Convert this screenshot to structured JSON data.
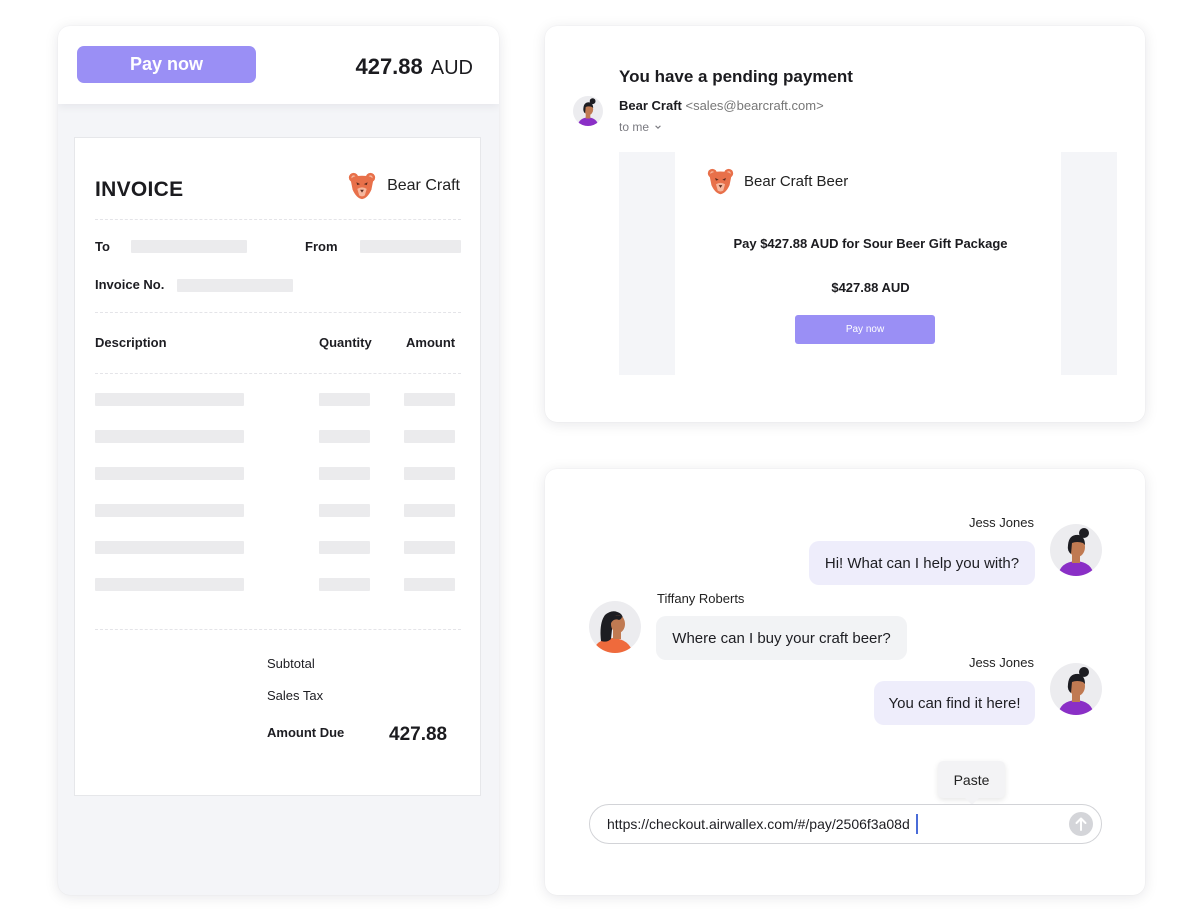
{
  "colors": {
    "accent": "#9a8ff5",
    "bear_orange": "#e8704a",
    "agent_bubble": "#eeedfb",
    "customer_bubble": "#f2f3f5"
  },
  "invoice_card": {
    "pay_button_label": "Pay now",
    "total_amount": "427.88",
    "total_currency": "AUD",
    "title": "INVOICE",
    "brand_icon": "bear-icon",
    "brand_name": "Bear Craft",
    "to_label": "To",
    "from_label": "From",
    "invoice_no_label": "Invoice No.",
    "columns": [
      "Description",
      "Quantity",
      "Amount"
    ],
    "placeholder_rows": 6,
    "subtotal_label": "Subtotal",
    "sales_tax_label": "Sales Tax",
    "amount_due_label": "Amount Due",
    "amount_due_value": "427.88"
  },
  "email_card": {
    "subject": "You have a pending payment",
    "sender_name": "Bear Craft",
    "sender_email": "<sales@bearcraft.com>",
    "to_line": "to me",
    "brand_name": "Bear Craft Beer",
    "pay_line": "Pay $427.88 AUD for Sour Beer Gift Package",
    "amount_line": "$427.88 AUD",
    "pay_button_label": "Pay now"
  },
  "chat_card": {
    "messages": [
      {
        "sender": "Jess Jones",
        "role": "agent",
        "text": "Hi! What can I help you with?"
      },
      {
        "sender": "Tiffany Roberts",
        "role": "customer",
        "text": "Where can I buy your craft beer?"
      },
      {
        "sender": "Jess Jones",
        "role": "agent",
        "text": "You can find it here!"
      }
    ],
    "paste_tooltip": "Paste",
    "input_value": "https://checkout.airwallex.com/#/pay/2506f3a08d",
    "send_icon": "arrow-up-icon"
  }
}
